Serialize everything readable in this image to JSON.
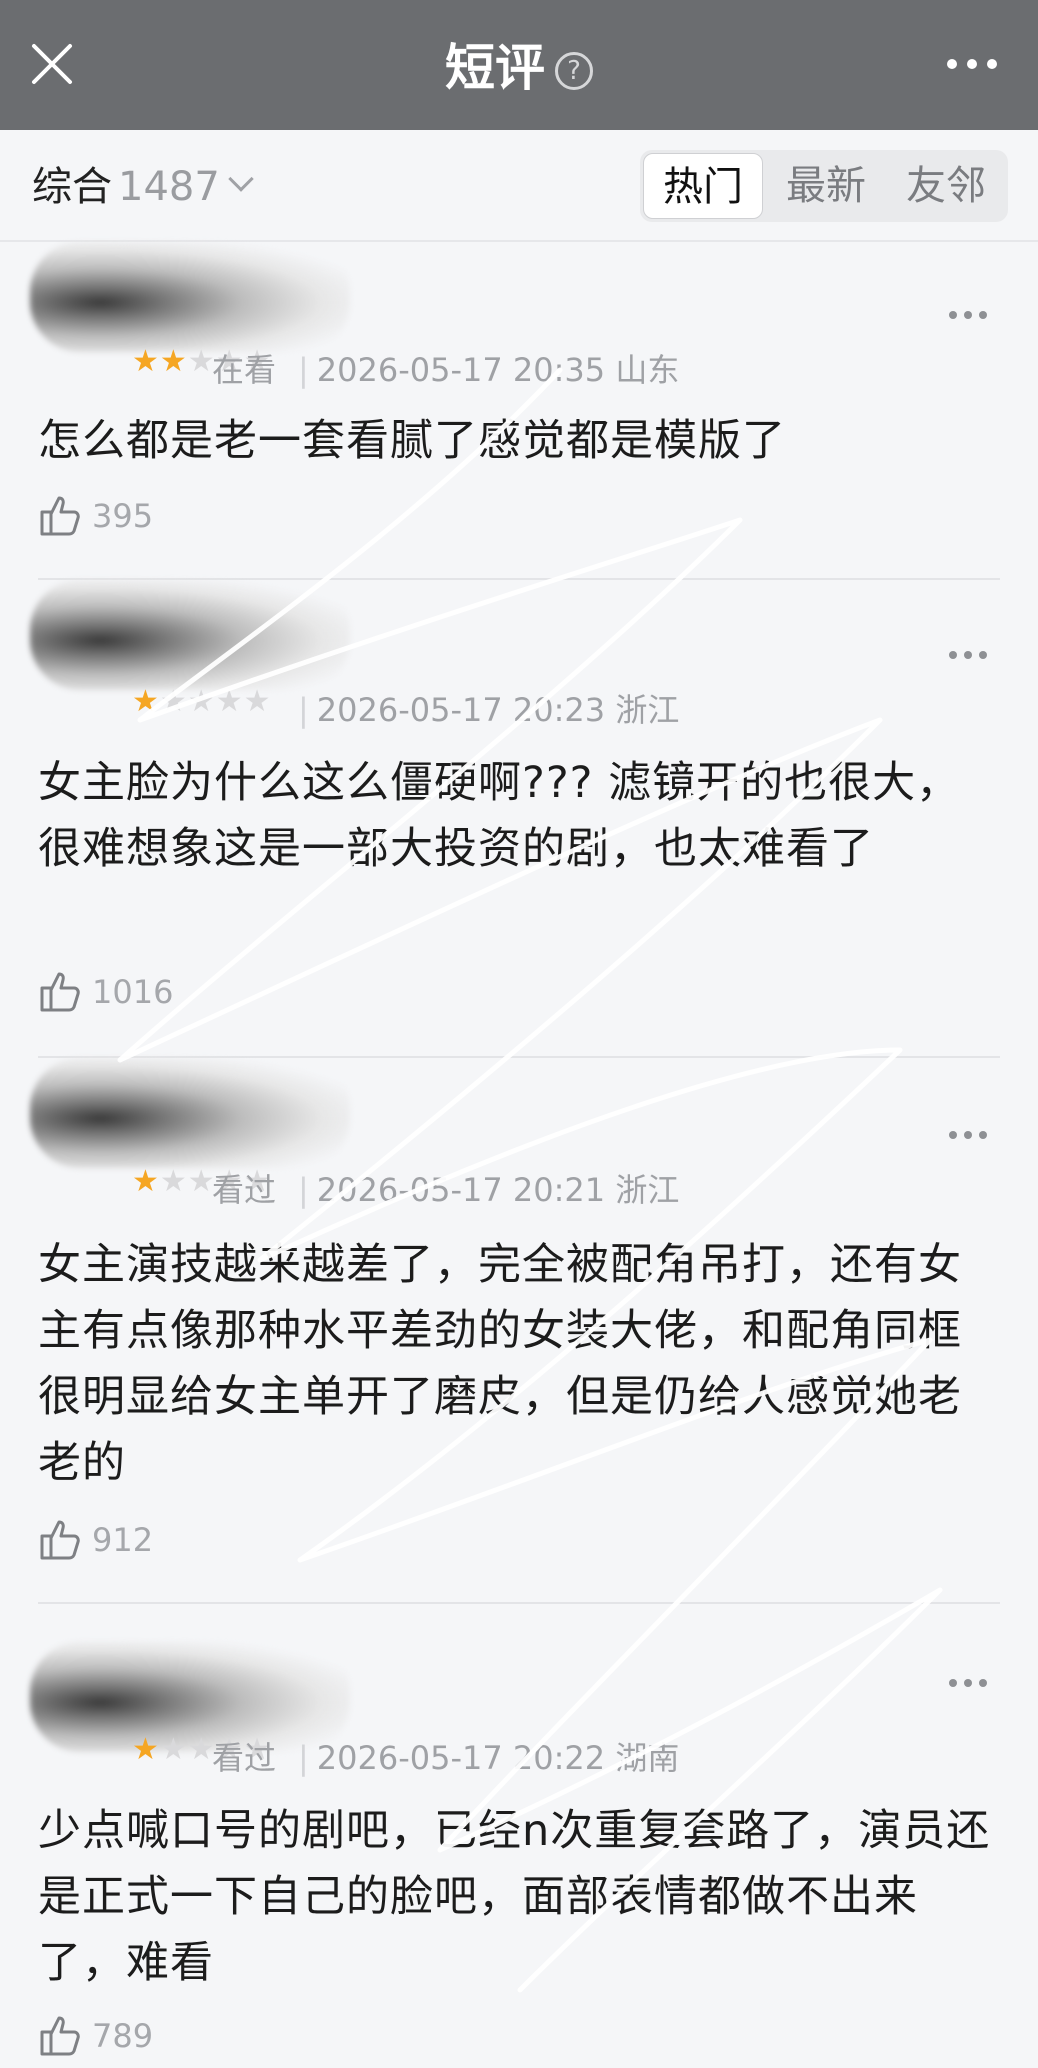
{
  "header": {
    "title": "短评",
    "help_icon": "?",
    "close_icon": "close-icon",
    "more_icon": "more-icon"
  },
  "filter": {
    "sort_label": "综合",
    "count": "1487",
    "tabs": [
      "热门",
      "最新",
      "友邻"
    ],
    "active_tab": "热门"
  },
  "reviews": [
    {
      "rating": 2,
      "state": "在看",
      "time": "2026-05-17 20:35",
      "location": "山东",
      "text": "怎么都是老一套看腻了感觉都是模版了",
      "likes": "395"
    },
    {
      "rating": 1,
      "state": "",
      "time": "2026-05-17 20:23",
      "location": "浙江",
      "text": "女主脸为什么这么僵硬啊??? 滤镜开的也很大，很难想象这是一部大投资的剧，也太难看了",
      "likes": "1016"
    },
    {
      "rating": 1,
      "state": "看过",
      "time": "2026-05-17 20:21",
      "location": "浙江",
      "text": "女主演技越来越差了，完全被配角吊打，还有女主有点像那种水平差劲的女装大佬，和配角同框很明显给女主单开了磨皮，但是仍给人感觉她老老的",
      "likes": "912"
    },
    {
      "rating": 1,
      "state": "看过",
      "time": "2026-05-17 20:22",
      "location": "湖南",
      "text": "少点喊口号的剧吧，已经n次重复套路了，演员还是正式一下自己的脸吧，面部表情都做不出来了，难看",
      "likes": "789"
    }
  ]
}
